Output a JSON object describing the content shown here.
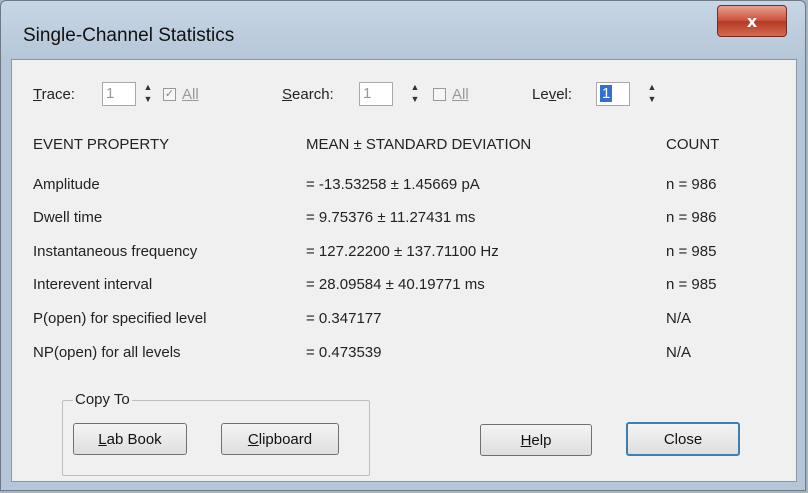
{
  "window": {
    "title": "Single-Channel Statistics",
    "close_glyph": "x"
  },
  "controls": {
    "trace": {
      "label_u": "T",
      "label_rest": "race:",
      "value": "1",
      "all_label": "All",
      "all_checked": true
    },
    "search": {
      "label_u": "S",
      "label_rest": "earch:",
      "value": "1",
      "all_label": "All",
      "all_checked": false
    },
    "level": {
      "label_pre": "Le",
      "label_u": "v",
      "label_rest": "el:",
      "value": "1"
    }
  },
  "table": {
    "headers": [
      "EVENT PROPERTY",
      "MEAN ± STANDARD DEVIATION",
      "COUNT"
    ],
    "rows": [
      {
        "property": "Amplitude",
        "value": "= -13.53258 ± 1.45669 pA",
        "count": "n = 986"
      },
      {
        "property": "Dwell time",
        "value": "= 9.75376 ± 11.27431 ms",
        "count": "n = 986"
      },
      {
        "property": "Instantaneous frequency",
        "value": "= 127.22200 ± 137.71100 Hz",
        "count": "n = 985"
      },
      {
        "property": "Interevent interval",
        "value": "= 28.09584 ± 40.19771 ms",
        "count": "n = 985"
      },
      {
        "property": "P(open) for specified level",
        "value": "= 0.347177",
        "count": "N/A"
      },
      {
        "property": "NP(open) for all levels",
        "value": "= 0.473539",
        "count": "N/A"
      }
    ]
  },
  "copy_to": {
    "legend": "Copy To",
    "lab_book": {
      "u": "L",
      "rest": "ab Book"
    },
    "clipboard": {
      "u": "C",
      "rest": "lipboard"
    }
  },
  "buttons": {
    "help": {
      "u": "H",
      "rest": "elp"
    },
    "close": "Close"
  }
}
